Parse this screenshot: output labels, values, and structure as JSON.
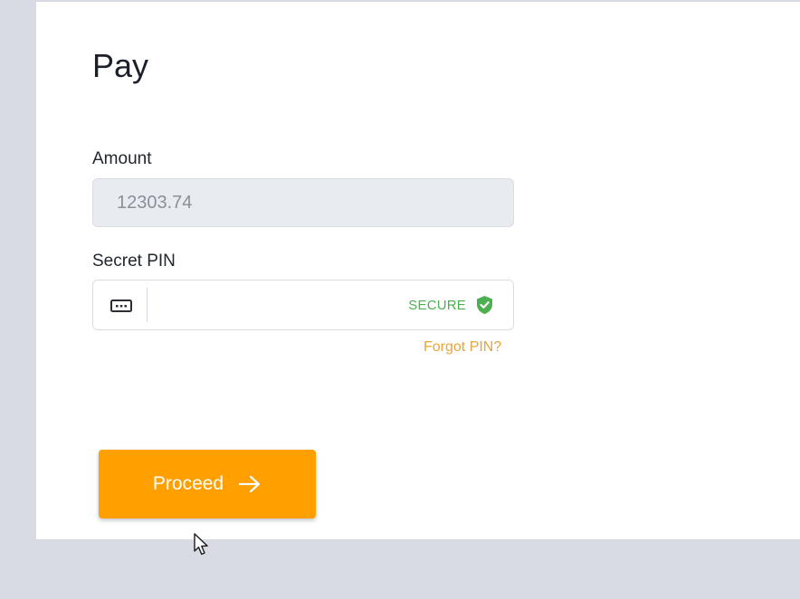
{
  "page": {
    "title": "Pay"
  },
  "form": {
    "amount_label": "Amount",
    "amount_value": "12303.74",
    "pin_label": "Secret PIN",
    "pin_value": "",
    "secure_label": "SECURE",
    "forgot_label": "Forgot PIN?",
    "proceed_label": "Proceed"
  },
  "icons": {
    "pin": "keyboard-dots-icon",
    "secure": "shield-check-icon",
    "proceed": "arrow-right-icon",
    "cursor": "mouse-pointer-icon"
  },
  "colors": {
    "accent": "#ffa000",
    "secure": "#4caf50",
    "link": "#e8a43a",
    "background": "#d8dbe3",
    "card": "#ffffff"
  }
}
